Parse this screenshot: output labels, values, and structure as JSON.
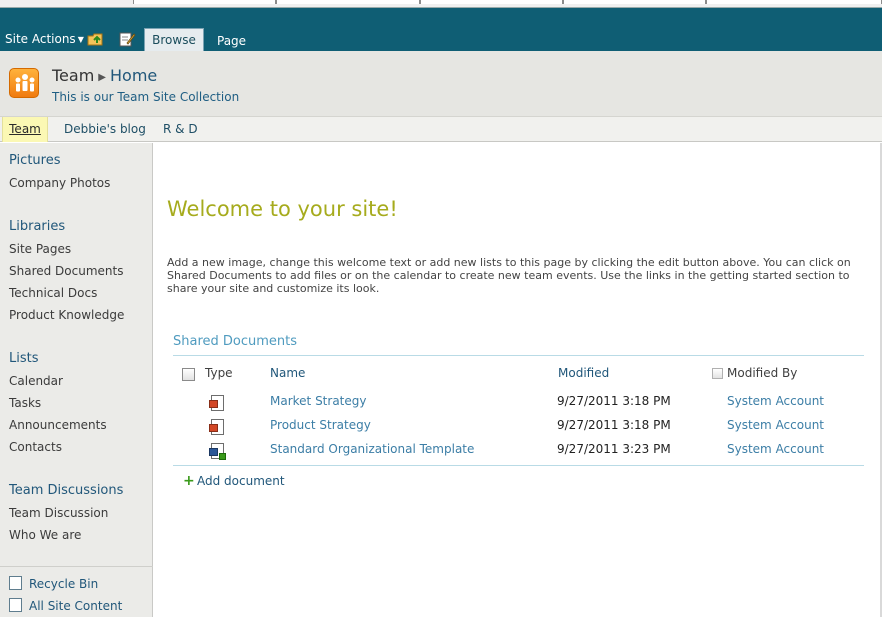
{
  "ribbon": {
    "site_actions": "Site Actions",
    "tabs": [
      "Browse",
      "Page"
    ]
  },
  "title_area": {
    "site_name": "Team",
    "page_name": "Home",
    "description": "This is our Team Site Collection"
  },
  "top_nav": [
    "Team",
    "Debbie's blog",
    "R & D"
  ],
  "quick_launch": {
    "pictures": {
      "heading": "Pictures",
      "items": [
        "Company Photos"
      ]
    },
    "libraries": {
      "heading": "Libraries",
      "items": [
        "Site Pages",
        "Shared Documents",
        "Technical Docs",
        "Product Knowledge"
      ]
    },
    "lists": {
      "heading": "Lists",
      "items": [
        "Calendar",
        "Tasks",
        "Announcements",
        "Contacts"
      ]
    },
    "discussions": {
      "heading": "Team Discussions",
      "items": [
        "Team Discussion",
        "Who We are"
      ]
    },
    "recycle_bin": "Recycle Bin",
    "all_site_content": "All Site Content"
  },
  "main": {
    "welcome_title": "Welcome to your site!",
    "welcome_text": "Add a new image, change this welcome text or add new lists to this page by clicking the edit button above. You can click on Shared Documents to add files or on the calendar to create new team events. Use the links in the getting started section to share your site and customize its look."
  },
  "shared_documents": {
    "title": "Shared Documents",
    "columns": {
      "type": "Type",
      "name": "Name",
      "modified": "Modified",
      "modified_by": "Modified By"
    },
    "rows": [
      {
        "icon": "powerpoint-icon",
        "name": "Market Strategy",
        "modified": "9/27/2011 3:18 PM",
        "modified_by": "System Account"
      },
      {
        "icon": "powerpoint-icon",
        "name": "Product Strategy",
        "modified": "9/27/2011 3:18 PM",
        "modified_by": "System Account"
      },
      {
        "icon": "word-icon",
        "name": "Standard Organizational Template",
        "modified": "9/27/2011 3:23 PM",
        "modified_by": "System Account"
      }
    ],
    "add_document": "Add document"
  },
  "colors": {
    "ribbon": "#0f5e74",
    "welcome_title": "#a6ab1d",
    "link": "#3c7ea6",
    "heading": "#21577a"
  }
}
